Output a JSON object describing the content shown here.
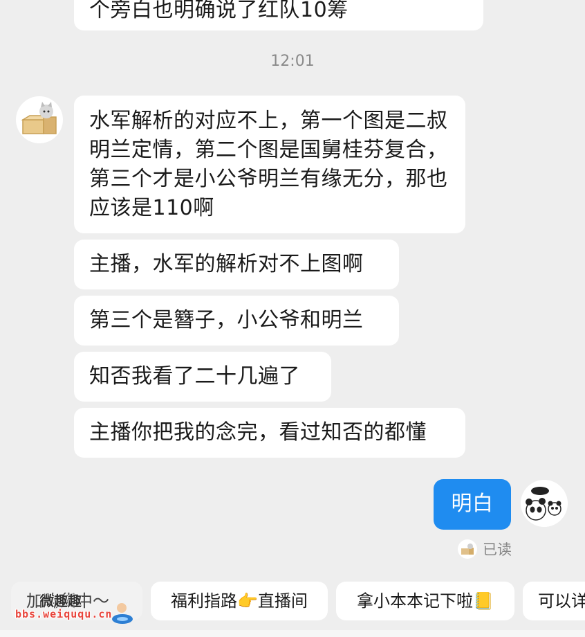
{
  "messages": {
    "prev_partial": "个旁白也明确说了红队10筹",
    "timestamp": "12:01",
    "incoming": [
      "水军解析的对应不上，第一个图是二叔明兰定情，第二个图是国舅桂芬复合，第三个才是小公爷明兰有缘无分，那也应该是110啊",
      "主播，水军的解析对不上图啊",
      "第三个是簪子，小公爷和明兰",
      "知否我看了二十几遍了",
      "主播你把我的念完，看过知否的都懂"
    ],
    "outgoing": "明白",
    "read_status": "已读"
  },
  "quick_replies": [
    "加购货中～",
    "福利指路👉直播间",
    "拿小本本记下啦📒",
    "可以详"
  ],
  "watermark": {
    "site": "bbs.weiququ.cn",
    "name": "微趣趣"
  },
  "colors": {
    "outgoing_bubble": "#1f8cf0",
    "background": "#eeeeee",
    "watermark": "#e8453c"
  },
  "icons": {
    "sender_avatar": "cat-in-box-avatar",
    "self_avatar": "panda-avatar"
  }
}
